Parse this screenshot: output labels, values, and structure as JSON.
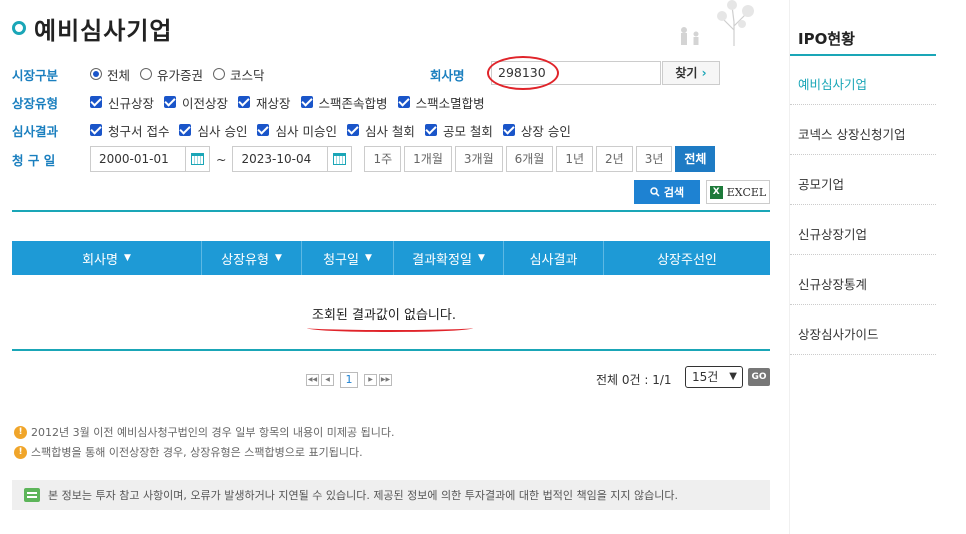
{
  "page": {
    "title": "예비심사기업"
  },
  "filters": {
    "market_label": "시장구분",
    "market_options": [
      {
        "label": "전체",
        "selected": true
      },
      {
        "label": "유가증권",
        "selected": false
      },
      {
        "label": "코스닥",
        "selected": false
      }
    ],
    "company_label": "회사명",
    "company_value": "298130",
    "find_label": "찾기",
    "listing_type_label": "상장유형",
    "listing_types": [
      "신규상장",
      "이전상장",
      "재상장",
      "스팩존속합병",
      "스팩소멸합병"
    ],
    "result_label": "심사결과",
    "results": [
      "청구서 접수",
      "심사 승인",
      "심사 미승인",
      "심사 철회",
      "공모 철회",
      "상장 승인"
    ],
    "date_label": "청 구 일",
    "date_from": "2000-01-01",
    "date_sep": "~",
    "date_to": "2023-10-04",
    "periods": [
      "1주",
      "1개월",
      "3개월",
      "6개월",
      "1년",
      "2년",
      "3년",
      "전체"
    ],
    "active_period": "전체",
    "search_label": "검색",
    "excel_label": "EXCEL"
  },
  "table": {
    "columns": [
      {
        "label": "회사명",
        "sortable": true
      },
      {
        "label": "상장유형",
        "sortable": true
      },
      {
        "label": "청구일",
        "sortable": true
      },
      {
        "label": "결과확정일",
        "sortable": true
      },
      {
        "label": "심사결과",
        "sortable": false
      },
      {
        "label": "상장주선인",
        "sortable": false
      }
    ],
    "empty_message": "조회된 결과값이 없습니다."
  },
  "pagination": {
    "current_page": "1",
    "total_text": "전체 0건 : 1/1",
    "page_size": "15건",
    "go_label": "GO"
  },
  "notes": [
    "2012년 3월 이전 예비심사청구법인의 경우 일부 항목의 내용이 미제공 됩니다.",
    "스팩합병을 통해 이전상장한 경우, 상장유형은 스팩합병으로 표기됩니다."
  ],
  "disclaimer": "본 정보는 투자 참고 사항이며, 오류가 발생하거나 지연될 수 있습니다. 제공된 정보에 의한 투자결과에 대한 법적인 책임을 지지 않습니다.",
  "sidebar": {
    "title": "IPO현황",
    "items": [
      {
        "label": "예비심사기업",
        "active": true
      },
      {
        "label": "코넥스 상장신청기업",
        "active": false
      },
      {
        "label": "공모기업",
        "active": false
      },
      {
        "label": "신규상장기업",
        "active": false
      },
      {
        "label": "신규상장통계",
        "active": false
      },
      {
        "label": "상장심사가이드",
        "active": false
      }
    ]
  },
  "colors": {
    "accent": "#1aa6b7",
    "header_bg": "#1e9ad6",
    "primary_button": "#1e82d2",
    "annotation_red": "#e0242a"
  }
}
